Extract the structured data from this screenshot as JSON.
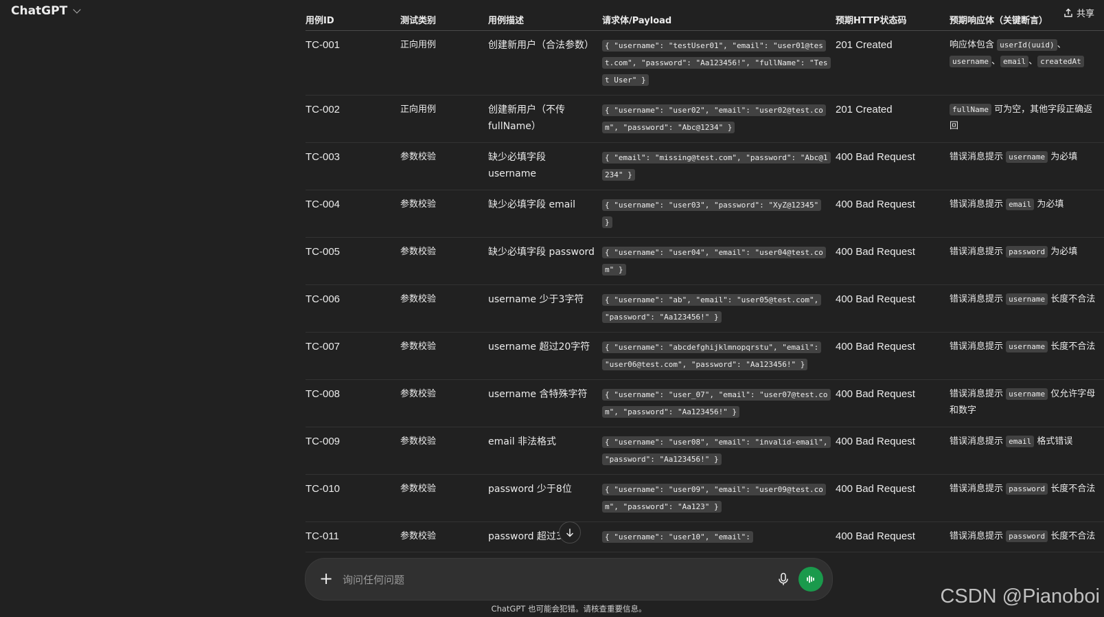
{
  "header": {
    "model_name": "ChatGPT",
    "share_label": "共享"
  },
  "table": {
    "headers": [
      "用例ID",
      "测试类别",
      "用例描述",
      "请求体/Payload",
      "预期HTTP状态码",
      "预期响应体（关键断言）"
    ],
    "rows": [
      {
        "id": "TC-001",
        "category": "正向用例",
        "description": "创建新用户（合法参数）",
        "payload": "{ \"username\": \"testUser01\", \"email\": \"user01@test.com\", \"password\": \"Aa123456!\", \"fullName\": \"Test User\" }",
        "status": "201 Created",
        "assertion": [
          {
            "t": "响应体包含 "
          },
          {
            "c": "userId(uuid)"
          },
          {
            "t": "、"
          },
          {
            "c": "username"
          },
          {
            "t": "、"
          },
          {
            "c": "email"
          },
          {
            "t": "、"
          },
          {
            "c": "createdAt"
          }
        ]
      },
      {
        "id": "TC-002",
        "category": "正向用例",
        "description": "创建新用户（不传 fullName）",
        "payload": "{ \"username\": \"user02\", \"email\": \"user02@test.com\", \"password\": \"Abc@1234\" }",
        "status": "201 Created",
        "assertion": [
          {
            "c": "fullName"
          },
          {
            "t": " 可为空，其他字段正确返回"
          }
        ]
      },
      {
        "id": "TC-003",
        "category": "参数校验",
        "description": "缺少必填字段 username",
        "payload": "{ \"email\": \"missing@test.com\", \"password\": \"Abc@1234\" }",
        "status": "400 Bad Request",
        "assertion": [
          {
            "t": "错误消息提示 "
          },
          {
            "c": "username"
          },
          {
            "t": " 为必填"
          }
        ]
      },
      {
        "id": "TC-004",
        "category": "参数校验",
        "description": "缺少必填字段 email",
        "payload": "{ \"username\": \"user03\", \"password\": \"XyZ@12345\" }",
        "status": "400 Bad Request",
        "assertion": [
          {
            "t": "错误消息提示 "
          },
          {
            "c": "email"
          },
          {
            "t": " 为必填"
          }
        ]
      },
      {
        "id": "TC-005",
        "category": "参数校验",
        "description": "缺少必填字段 password",
        "payload": "{ \"username\": \"user04\", \"email\": \"user04@test.com\" }",
        "status": "400 Bad Request",
        "assertion": [
          {
            "t": "错误消息提示 "
          },
          {
            "c": "password"
          },
          {
            "t": " 为必填"
          }
        ]
      },
      {
        "id": "TC-006",
        "category": "参数校验",
        "description": "username 少于3字符",
        "payload": "{ \"username\": \"ab\", \"email\": \"user05@test.com\", \"password\": \"Aa123456!\" }",
        "status": "400 Bad Request",
        "assertion": [
          {
            "t": "错误消息提示 "
          },
          {
            "c": "username"
          },
          {
            "t": " 长度不合法"
          }
        ]
      },
      {
        "id": "TC-007",
        "category": "参数校验",
        "description": "username 超过20字符",
        "payload": "{ \"username\": \"abcdefghijklmnopqrstu\", \"email\": \"user06@test.com\", \"password\": \"Aa123456!\" }",
        "status": "400 Bad Request",
        "assertion": [
          {
            "t": "错误消息提示 "
          },
          {
            "c": "username"
          },
          {
            "t": " 长度不合法"
          }
        ]
      },
      {
        "id": "TC-008",
        "category": "参数校验",
        "description": "username 含特殊字符",
        "payload": "{ \"username\": \"user_07\", \"email\": \"user07@test.com\", \"password\": \"Aa123456!\" }",
        "status": "400 Bad Request",
        "assertion": [
          {
            "t": "错误消息提示 "
          },
          {
            "c": "username"
          },
          {
            "t": " 仅允许字母和数字"
          }
        ]
      },
      {
        "id": "TC-009",
        "category": "参数校验",
        "description": "email 非法格式",
        "payload": "{ \"username\": \"user08\", \"email\": \"invalid-email\", \"password\": \"Aa123456!\" }",
        "status": "400 Bad Request",
        "assertion": [
          {
            "t": "错误消息提示 "
          },
          {
            "c": "email"
          },
          {
            "t": " 格式错误"
          }
        ]
      },
      {
        "id": "TC-010",
        "category": "参数校验",
        "description": "password 少于8位",
        "payload": "{ \"username\": \"user09\", \"email\": \"user09@test.com\", \"password\": \"Aa123\" }",
        "status": "400 Bad Request",
        "assertion": [
          {
            "t": "错误消息提示 "
          },
          {
            "c": "password"
          },
          {
            "t": " 长度不合法"
          }
        ]
      },
      {
        "id": "TC-011",
        "category": "参数校验",
        "description": "password 超过30位",
        "payload": "{ \"username\": \"user10\", \"email\":",
        "status": "400 Bad Request",
        "assertion": [
          {
            "t": "错误消息提示 "
          },
          {
            "c": "password"
          },
          {
            "t": " 长度不合法"
          }
        ]
      }
    ]
  },
  "composer": {
    "placeholder": "询问任何问题",
    "plus_icon": "plus-icon",
    "mic_icon": "microphone-icon",
    "voice_icon": "voice-mode-icon"
  },
  "footer": {
    "disclaimer": "ChatGPT 也可能会犯错。请核查重要信息。"
  },
  "watermark": "CSDN @Pianoboi",
  "colors": {
    "background": "#212121",
    "composer_bg": "#303030",
    "code_bg": "#424242",
    "voice_button": "#1a9a4c",
    "text": "#ececec"
  }
}
